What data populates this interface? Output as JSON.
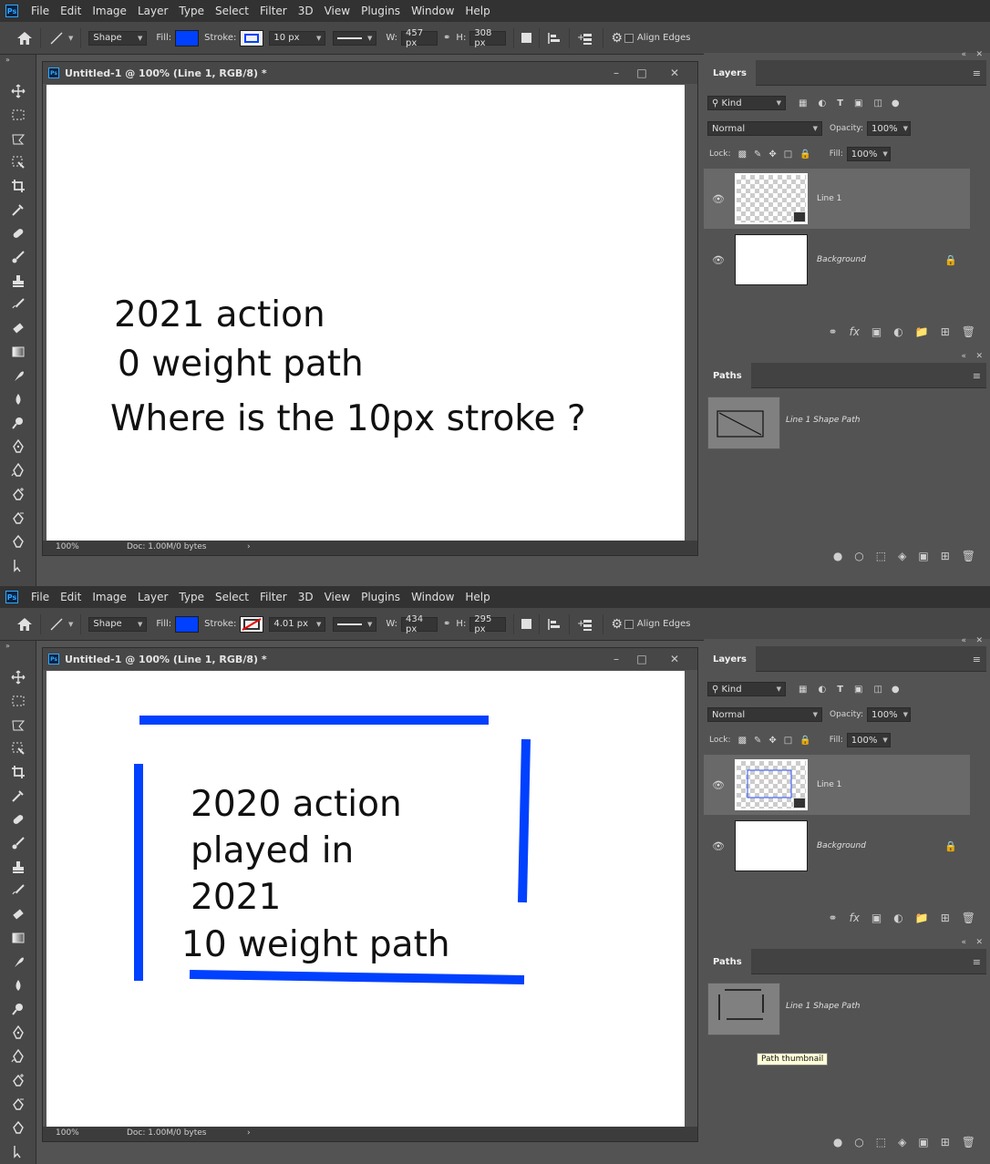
{
  "menu": [
    "File",
    "Edit",
    "Image",
    "Layer",
    "Type",
    "Select",
    "Filter",
    "3D",
    "View",
    "Plugins",
    "Window",
    "Help"
  ],
  "app_logo": "Ps",
  "options": {
    "mode_value": "Shape",
    "fill_label": "Fill:",
    "stroke_label": "Stroke:",
    "w_label": "W:",
    "h_label": "H:",
    "align_edges_label": "Align Edges",
    "fill_color": "#0040ff"
  },
  "shots": [
    {
      "options": {
        "stroke_width": "10 px",
        "w_value": "457 px",
        "h_value": "308 px"
      },
      "doc_title": "Untitled-1 @ 100% (Line 1, RGB/8) *",
      "zoom": "100%",
      "doc_info": "Doc: 1.00M/0 bytes",
      "canvas_text": [
        "2021 action",
        "0 weight path",
        "Where is the 10px stroke ?"
      ],
      "layers": {
        "tab": "Layers",
        "kind": "Kind",
        "blend_mode": "Normal",
        "opacity_label": "Opacity:",
        "opacity_value": "100%",
        "lock_label": "Lock:",
        "fill_label": "Fill:",
        "fill_value": "100%",
        "items": [
          {
            "name": "Line 1"
          },
          {
            "name": "Background"
          }
        ]
      },
      "paths": {
        "tab": "Paths",
        "items": [
          {
            "name": "Line 1 Shape Path"
          }
        ]
      }
    },
    {
      "options": {
        "stroke_width": "4.01 px",
        "w_value": "434 px",
        "h_value": "295 px"
      },
      "doc_title": "Untitled-1 @ 100% (Line 1, RGB/8) *",
      "zoom": "100%",
      "doc_info": "Doc: 1.00M/0 bytes",
      "canvas_text": [
        "2020 action",
        "played in",
        "2021",
        "10 weight path"
      ],
      "layers": {
        "tab": "Layers",
        "kind": "Kind",
        "blend_mode": "Normal",
        "opacity_label": "Opacity:",
        "opacity_value": "100%",
        "lock_label": "Lock:",
        "fill_label": "Fill:",
        "fill_value": "100%",
        "items": [
          {
            "name": "Line 1"
          },
          {
            "name": "Background"
          }
        ]
      },
      "paths": {
        "tab": "Paths",
        "items": [
          {
            "name": "Line 1 Shape Path"
          }
        ],
        "tooltip": "Path thumbnail"
      }
    }
  ]
}
